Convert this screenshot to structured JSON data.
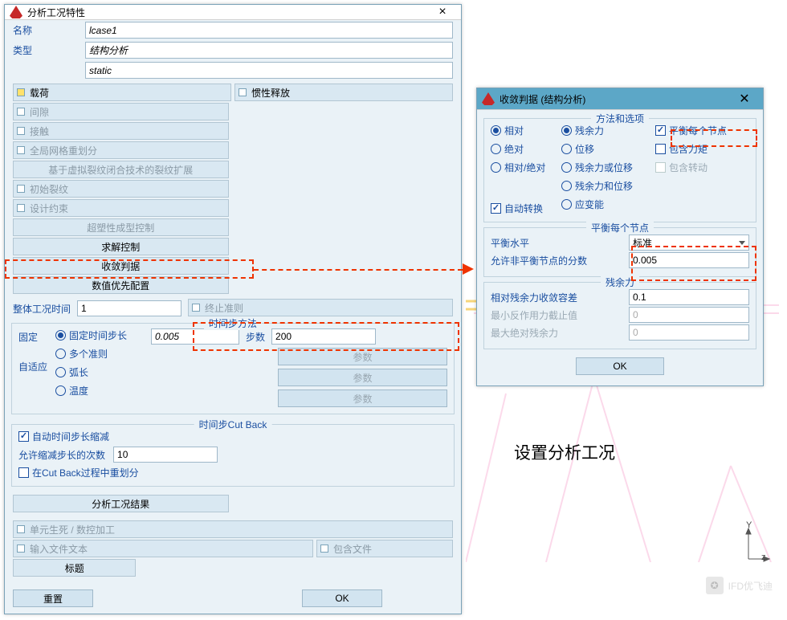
{
  "dlg1": {
    "title": "分析工况特性",
    "name_label": "名称",
    "name_value": "lcase1",
    "type_label": "类型",
    "type_value1": "结构分析",
    "type_value2": "static",
    "opts": {
      "load": "载荷",
      "inertia": "惯性释放",
      "gap": "间隙",
      "contact": "接触",
      "remesh": "全局网格重划分",
      "vcct": "基于虚拟裂纹闭合技术的裂纹扩展",
      "initcrack": "初始裂纹",
      "design": "设计约束",
      "superplastic": "超塑性成型控制",
      "solve": "求解控制",
      "converge": "收敛判据",
      "numpref": "数值优先配置"
    },
    "totaltime_label": "整体工况时间",
    "totaltime_value": "1",
    "term_label": "终止准则",
    "step_legend": "时间步方法",
    "fixed_label": "固定",
    "adaptive_label": "自适应",
    "r_fixed": "固定时间步长",
    "r_multi": "多个准则",
    "r_arc": "弧长",
    "r_temp": "温度",
    "stepsize_value": "0.005",
    "steps_label": "步数",
    "steps_value": "200",
    "params_label": "参数",
    "cutback_legend": "时间步Cut Back",
    "cb_auto": "自动时间步长缩减",
    "cb_allow_label": "允许缩减步长的次数",
    "cb_allow_value": "10",
    "cb_remesh": "在Cut Back过程中重划分",
    "results_label": "分析工况结果",
    "birth": "单元生死 / 数控加工",
    "inputtext": "输入文件文本",
    "includefile": "包含文件",
    "titlebar_label": "标题",
    "reset": "重置",
    "ok": "OK"
  },
  "dlg2": {
    "title": "收敛判据  (结构分析)",
    "g1_legend": "方法和选项",
    "c1": {
      "rel": "相对",
      "abs": "绝对",
      "relabs": "相对/绝对",
      "autoswitch": "自动转换"
    },
    "c2": {
      "resid": "残余力",
      "disp": "位移",
      "residordisp": "残余力或位移",
      "residanddisp": "残余力和位移",
      "strain": "应变能"
    },
    "c3": {
      "pernod": "平衡每个节点",
      "moment": "包含力矩",
      "rot": "包含转动"
    },
    "g2_legend": "平衡每个节点",
    "balance_label": "平衡水平",
    "balance_value": "标准",
    "allowfrac_label": "允许非平衡节点的分数",
    "allowfrac_value": "0.005",
    "g3_legend": "残余力",
    "reltol_label": "相对残余力收敛容差",
    "reltol_value": "0.1",
    "minreac_label": "最小反作用力截止值",
    "minreac_value": "0",
    "maxabs_label": "最大绝对残余力",
    "maxabs_value": "0",
    "ok": "OK"
  },
  "caption": "设置分析工况",
  "watermark": "IFD优飞迪",
  "axis": {
    "y": "Y",
    "z": "z"
  }
}
